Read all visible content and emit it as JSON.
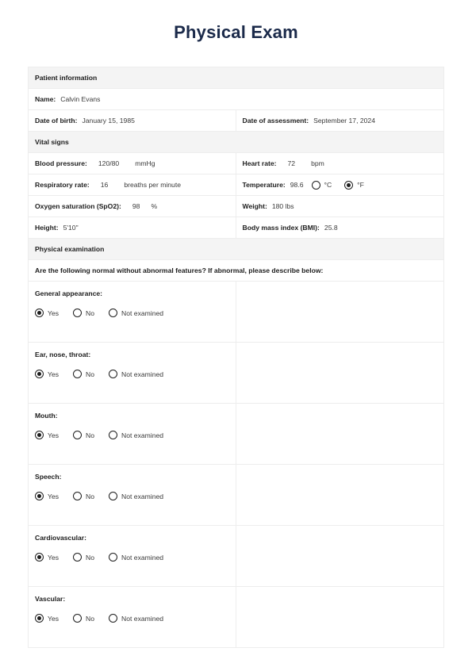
{
  "title": "Physical Exam",
  "sections": {
    "patient_information": "Patient information",
    "vital_signs": "Vital signs",
    "physical_examination": "Physical examination"
  },
  "patient": {
    "name_label": "Name:",
    "name_value": "Calvin Evans",
    "dob_label": "Date of birth:",
    "dob_value": "January 15, 1985",
    "assessment_label": "Date of assessment:",
    "assessment_value": "September 17, 2024"
  },
  "vitals": {
    "blood_pressure_label": "Blood pressure:",
    "blood_pressure_value": "120/80",
    "blood_pressure_unit": "mmHg",
    "heart_rate_label": "Heart rate:",
    "heart_rate_value": "72",
    "heart_rate_unit": "bpm",
    "respiratory_rate_label": "Respiratory rate:",
    "respiratory_rate_value": "16",
    "respiratory_rate_unit": "breaths per minute",
    "temperature_label": "Temperature:",
    "temperature_value": "98.6",
    "temperature_unit_c": "°C",
    "temperature_unit_f": "°F",
    "temperature_unit_selected": "°F",
    "oxygen_label": "Oxygen saturation (SpO2):",
    "oxygen_value": "98",
    "oxygen_unit": "%",
    "weight_label": "Weight:",
    "weight_value": "180 lbs",
    "height_label": "Height:",
    "height_value": "5'10\"",
    "bmi_label": "Body mass index (BMI):",
    "bmi_value": "25.8"
  },
  "exam": {
    "question": "Are the following normal without abnormal features? If abnormal, please describe below:",
    "options": [
      "Yes",
      "No",
      "Not examined"
    ],
    "items": [
      {
        "label": "General appearance:",
        "selected": "Yes",
        "notes": ""
      },
      {
        "label": "Ear, nose, throat:",
        "selected": "Yes",
        "notes": ""
      },
      {
        "label": "Mouth:",
        "selected": "Yes",
        "notes": ""
      },
      {
        "label": "Speech:",
        "selected": "Yes",
        "notes": ""
      },
      {
        "label": "Cardiovascular:",
        "selected": "Yes",
        "notes": ""
      },
      {
        "label": "Vascular:",
        "selected": "Yes",
        "notes": ""
      }
    ]
  },
  "colors": {
    "title": "#1b2a4a",
    "section_header_bg": "#f4f4f4",
    "border": "#ededed",
    "text": "#1d1d1d"
  }
}
